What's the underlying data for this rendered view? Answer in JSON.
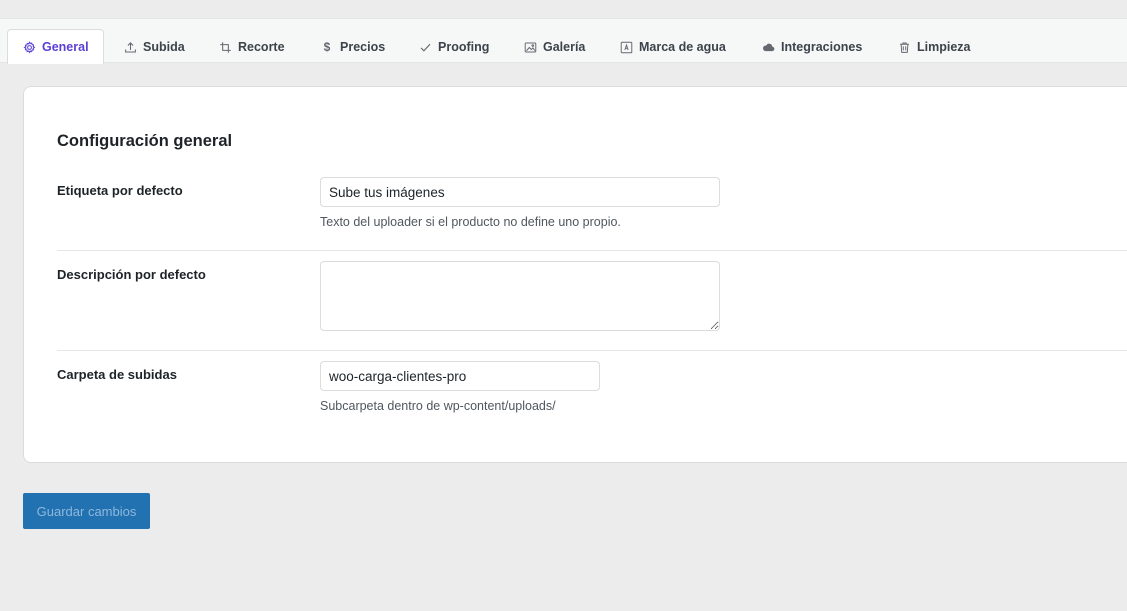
{
  "tabs": [
    {
      "label": "General",
      "icon": "gear-icon",
      "active": true
    },
    {
      "label": "Subida",
      "icon": "upload-icon",
      "active": false
    },
    {
      "label": "Recorte",
      "icon": "crop-icon",
      "active": false
    },
    {
      "label": "Precios",
      "icon": "dollar-icon",
      "active": false,
      "glyph": "$"
    },
    {
      "label": "Proofing",
      "icon": "checkmark-icon",
      "active": false
    },
    {
      "label": "Galería",
      "icon": "gallery-icon",
      "active": false
    },
    {
      "label": "Marca de agua",
      "icon": "watermark-icon",
      "active": false
    },
    {
      "label": "Integraciones",
      "icon": "cloud-icon",
      "active": false
    },
    {
      "label": "Limpieza",
      "icon": "trash-icon",
      "active": false
    }
  ],
  "colors": {
    "accent": "#5b3fd6",
    "primary_button": "#2271b1",
    "background": "#ececec"
  },
  "section": {
    "title": "Configuración general"
  },
  "fields": {
    "default_label": {
      "label": "Etiqueta por defecto",
      "value": "Sube tus imágenes",
      "help": "Texto del uploader si el producto no define uno propio."
    },
    "default_description": {
      "label": "Descripción por defecto",
      "value": ""
    },
    "upload_folder": {
      "label": "Carpeta de subidas",
      "value": "woo-carga-clientes-pro",
      "help": "Subcarpeta dentro de wp-content/uploads/"
    }
  },
  "actions": {
    "save_label": "Guardar cambios"
  }
}
